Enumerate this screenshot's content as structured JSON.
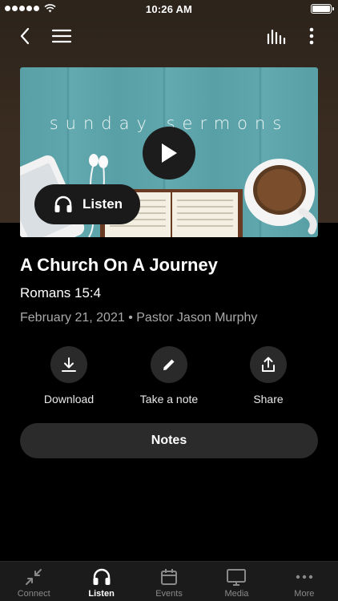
{
  "status_bar": {
    "time": "10:26 AM"
  },
  "nav": {
    "back_icon": "chevron-left-icon",
    "menu_icon": "hamburger-icon",
    "audio_icon": "equalizer-icon",
    "more_icon": "vertical-dots-icon"
  },
  "art": {
    "title": "sunday sermons",
    "listen_label": "Listen"
  },
  "sermon": {
    "title": "A Church On A Journey",
    "scripture": "Romans 15:4",
    "meta": "February 21, 2021 • Pastor Jason Murphy"
  },
  "actions": [
    {
      "label": "Download",
      "icon": "download-icon"
    },
    {
      "label": "Take a note",
      "icon": "pencil-icon"
    },
    {
      "label": "Share",
      "icon": "share-icon"
    }
  ],
  "notes_label": "Notes",
  "tabs": [
    {
      "label": "Connect",
      "icon": "connect-icon",
      "active": false
    },
    {
      "label": "Listen",
      "icon": "headphones-icon",
      "active": true
    },
    {
      "label": "Events",
      "icon": "calendar-icon",
      "active": false
    },
    {
      "label": "Media",
      "icon": "tv-icon",
      "active": false
    },
    {
      "label": "More",
      "icon": "dots-icon",
      "active": false
    }
  ],
  "colors": {
    "hero_bg": "#2d241c",
    "background": "#000000",
    "tab_active": "#ffffff",
    "tab_inactive": "#8a8a8a"
  }
}
